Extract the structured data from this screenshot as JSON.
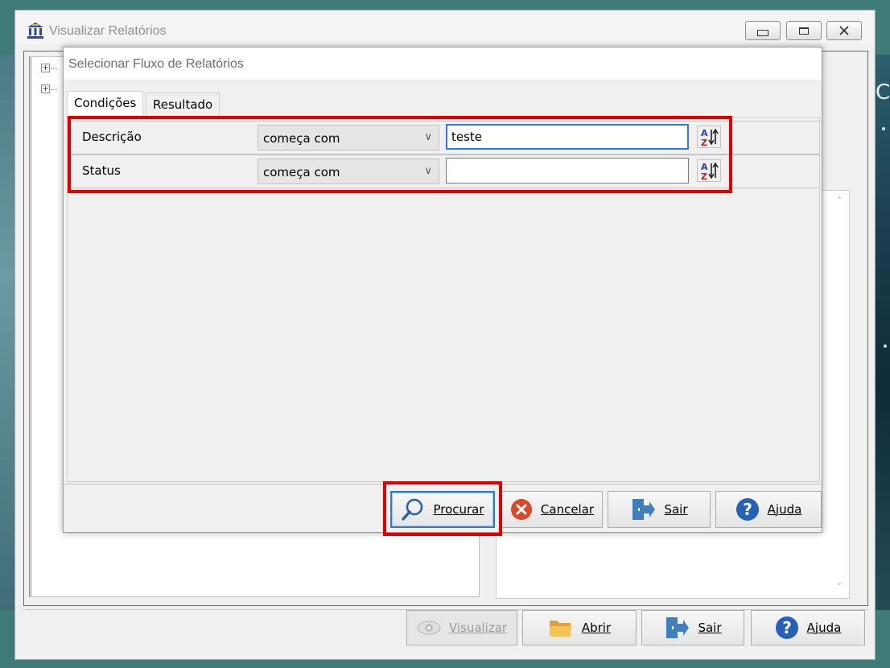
{
  "window": {
    "title": "Visualizar Relatórios",
    "icon": "bank-icon"
  },
  "dialog": {
    "title": "Selecionar Fluxo de Relatórios",
    "tabs": [
      {
        "label": "Condições",
        "active": true
      },
      {
        "label": "Resultado",
        "active": false
      }
    ],
    "conditions": [
      {
        "field": "Descrição",
        "operator": "começa com",
        "value": "teste"
      },
      {
        "field": "Status",
        "operator": "começa com",
        "value": ""
      }
    ],
    "buttons": {
      "procurar": "Procurar",
      "cancelar": "Cancelar",
      "sair": "Sair",
      "ajuda": "Ajuda"
    }
  },
  "main_buttons": {
    "visualizar": "Visualizar",
    "abrir": "Abrir",
    "sair": "Sair",
    "ajuda": "Ajuda"
  },
  "background": {
    "glyph": "C"
  },
  "colors": {
    "highlight": "#e00000",
    "focus": "#2f7bd3",
    "background": "#3e7a76"
  }
}
